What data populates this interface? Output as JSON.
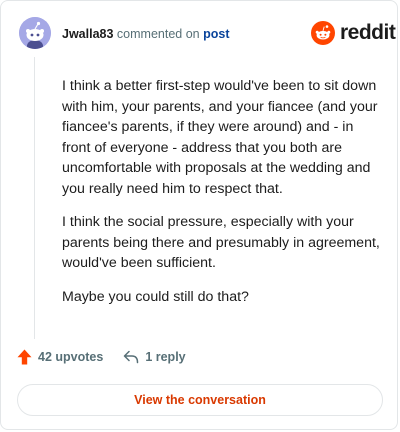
{
  "header": {
    "username": "Jwalla83",
    "commented_on": "commented on",
    "post_link": "post",
    "logo_text": "reddit"
  },
  "comment": {
    "paragraphs": [
      "I think a better first-step would've been to sit down with him, your parents, and your fiancee (and your fiancee's parents, if they were around) and - in front of everyone - address that you both are uncomfortable with proposals at the wedding and you really need him to respect that.",
      "I think the social pressure, especially with your parents being there and presumably in agreement, would've been sufficient.",
      "Maybe you could still do that?"
    ]
  },
  "actions": {
    "upvotes": "42 upvotes",
    "replies": "1 reply"
  },
  "cta": {
    "label": "View the conversation"
  },
  "colors": {
    "brand": "#ff4500",
    "cta_text": "#d93900",
    "link": "#0a449b",
    "muted": "#576f76",
    "avatar_bg": "#a5a8e6"
  },
  "icons": {
    "avatar": "snoo-avatar-icon",
    "logo": "reddit-logo-icon",
    "upvote": "upvote-arrow-icon",
    "reply": "reply-arrow-icon"
  }
}
